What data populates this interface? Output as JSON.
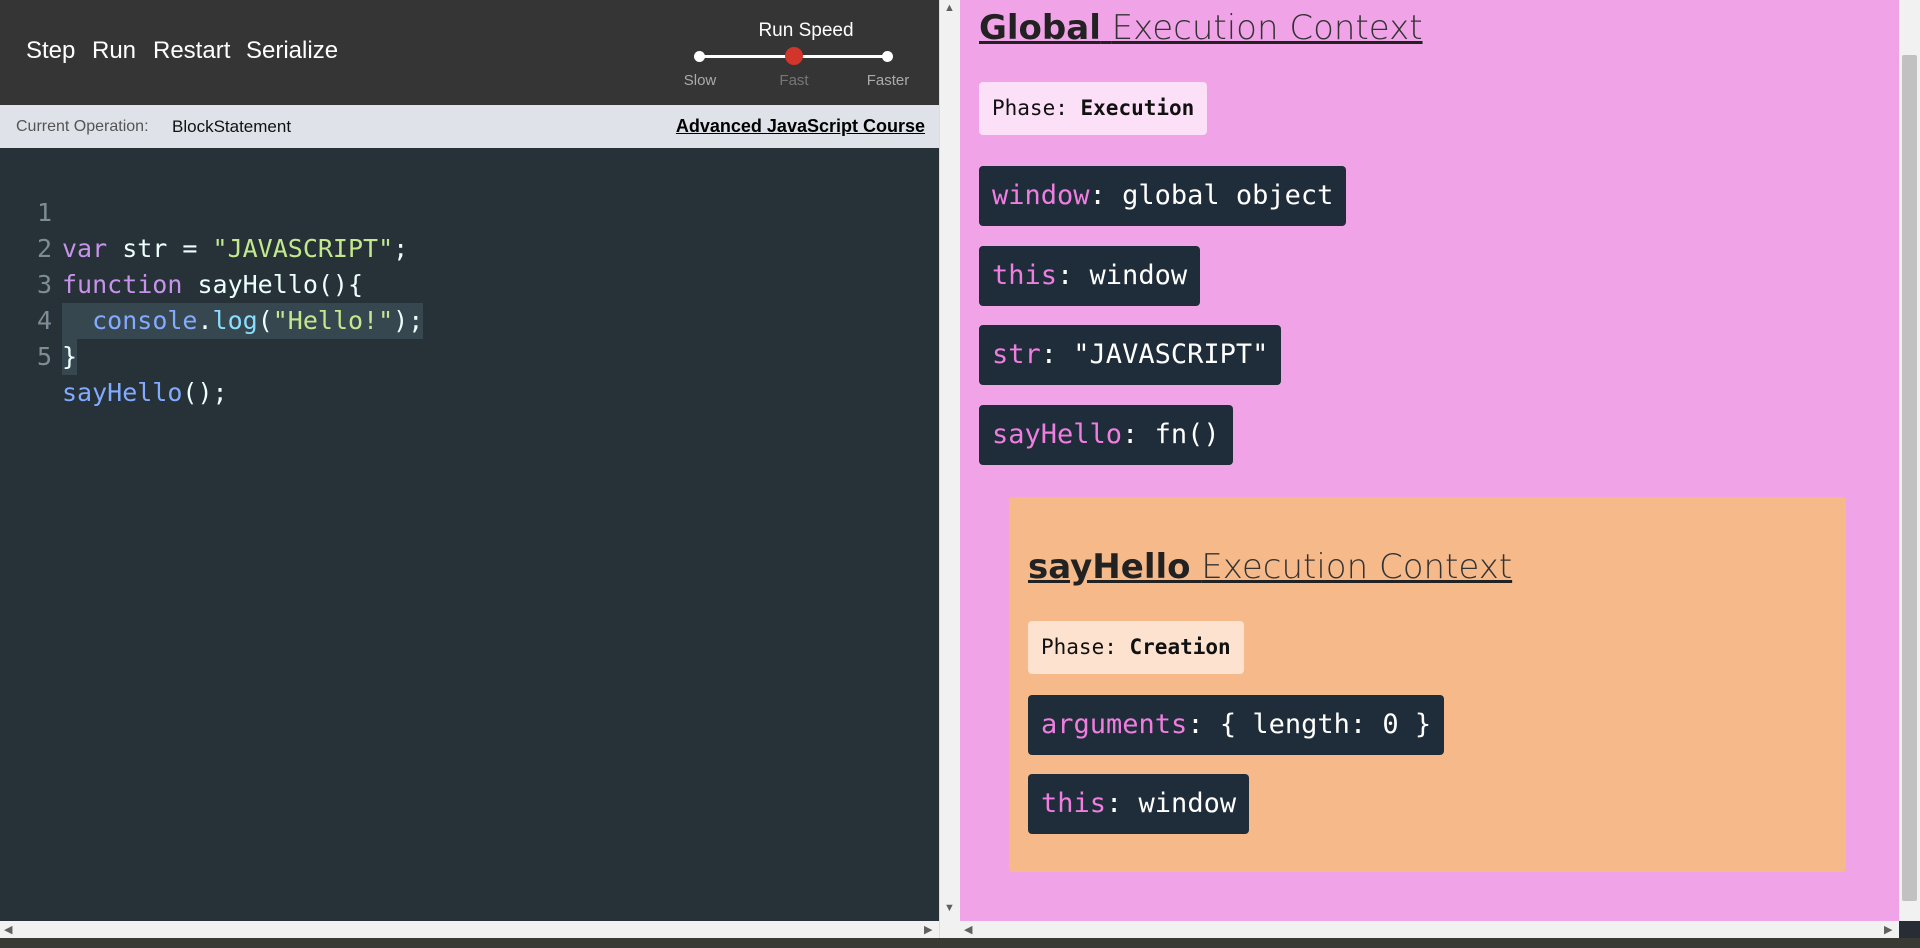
{
  "toolbar": {
    "step_label": "Step",
    "run_label": "Run",
    "restart_label": "Restart",
    "serialize_label": "Serialize",
    "speed": {
      "title": "Run Speed",
      "ticks": [
        "Slow",
        "Fast",
        "Faster"
      ],
      "selected": "Fast",
      "knob_color": "#d2352a"
    }
  },
  "status_bar": {
    "current_operation_label": "Current Operation:",
    "current_operation_value": "BlockStatement",
    "course_link": "Advanced JavaScript Course"
  },
  "editor": {
    "highlighted_line": 3,
    "lines": [
      {
        "num": "1",
        "text": "var str = \"JAVASCRIPT\";"
      },
      {
        "num": "2",
        "text": "function sayHello(){"
      },
      {
        "num": "3",
        "text": "  console.log(\"Hello!\");"
      },
      {
        "num": "4",
        "text": "}"
      },
      {
        "num": "5",
        "text": "sayHello();"
      }
    ]
  },
  "global_context": {
    "title_bold": "Global",
    "title_rest": "Execution Context",
    "phase_label": "Phase:",
    "phase_value": "Execution",
    "background_color": "#f1a3e8",
    "variables": [
      {
        "name": "window",
        "value": "global object"
      },
      {
        "name": "this",
        "value": "window"
      },
      {
        "name": "str",
        "value": "\"JAVASCRIPT\""
      },
      {
        "name": "sayHello",
        "value": "fn()"
      }
    ]
  },
  "function_context": {
    "title_bold": "sayHello",
    "title_rest": "Execution Context",
    "phase_label": "Phase:",
    "phase_value": "Creation",
    "background_color": "#f6b98a",
    "variables": [
      {
        "name": "arguments",
        "value": "{ length: 0 }"
      },
      {
        "name": "this",
        "value": "window"
      }
    ]
  }
}
